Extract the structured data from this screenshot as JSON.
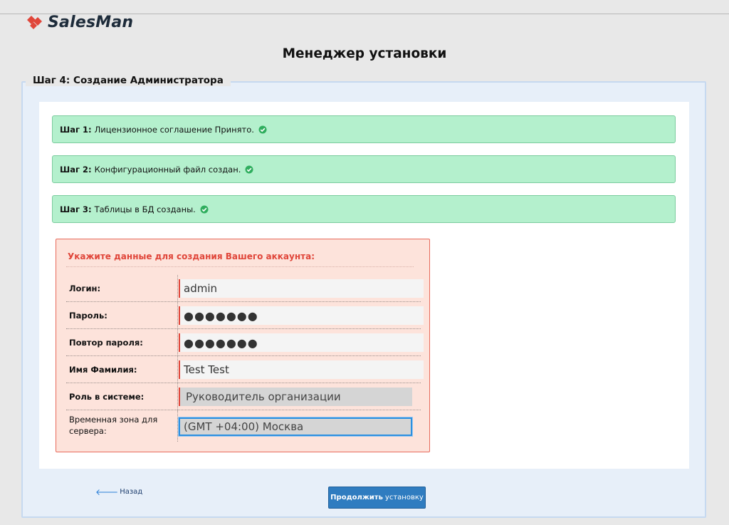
{
  "brand": {
    "name": "SalesMan"
  },
  "header": {
    "title": "Менеджер установки"
  },
  "step_legend": "Шаг 4: Создание Администратора",
  "completed_steps": [
    {
      "label": "Шаг 1:",
      "text": "Лицензионное соглашение Принято."
    },
    {
      "label": "Шаг 2:",
      "text": "Конфигурационный файл создан."
    },
    {
      "label": "Шаг 3:",
      "text": "Таблицы в БД созданы."
    }
  ],
  "form": {
    "title": "Укажите данные для создания Вашего аккаунта:",
    "login_label": "Логин:",
    "login_value": "admin",
    "password_label": "Пароль:",
    "password_value": "●●●●●●●",
    "password_repeat_label": "Повтор пароля:",
    "password_repeat_value": "●●●●●●●",
    "fullname_label": "Имя Фамилия:",
    "fullname_value": "Test Test",
    "role_label": "Роль в системе:",
    "role_value": "Руководитель организации",
    "timezone_label": "Временная зона для сервера:",
    "timezone_value": "(GMT +04:00) Москва"
  },
  "nav": {
    "back_label": "Назад",
    "continue_bold": "Продолжить",
    "continue_rest": "установку"
  },
  "colors": {
    "accent": "#2f7cc0",
    "success_bg": "#b4f0cd",
    "error_text": "#e0463a",
    "form_bg": "#fde3db",
    "logo_red": "#e0463a"
  }
}
